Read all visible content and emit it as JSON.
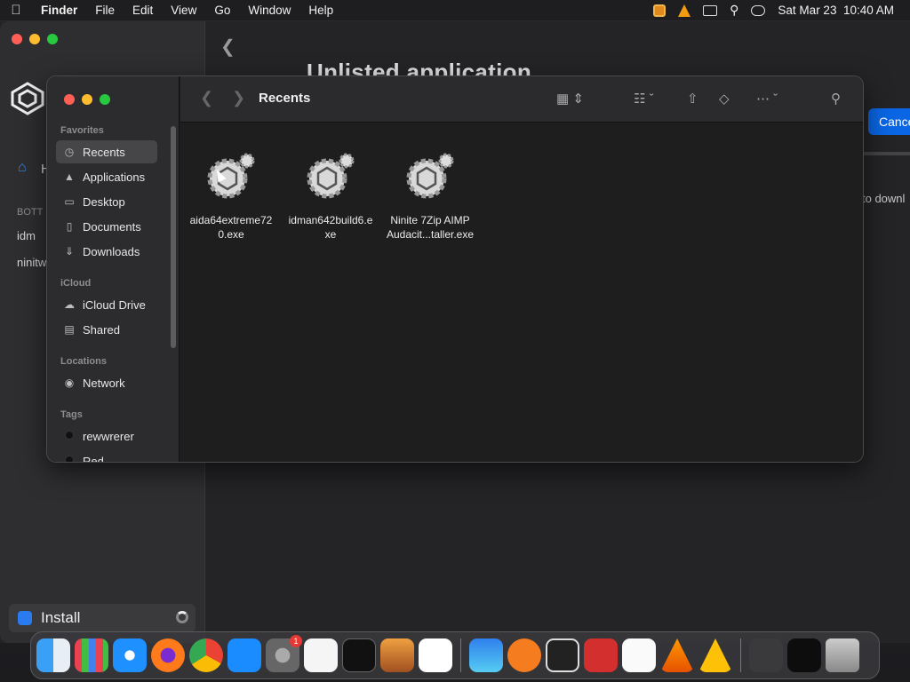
{
  "menubar": {
    "app_name": "Finder",
    "menus": [
      "File",
      "Edit",
      "View",
      "Go",
      "Window",
      "Help"
    ],
    "datetime": "Sat Mar 23  10:40 AM"
  },
  "background_window": {
    "title": "Unlisted application",
    "cancel_label": "Cance",
    "download_text": "to downl",
    "sidebar_home_label": "H",
    "sidebar_section": "BOTT",
    "sidebar_items": [
      "idm",
      "ninitw"
    ],
    "install_label": "Install"
  },
  "finder": {
    "title": "Recents",
    "sidebar": {
      "favorites_header": "Favorites",
      "favorites": [
        {
          "label": "Recents",
          "icon": "clock-icon"
        },
        {
          "label": "Applications",
          "icon": "applications-icon"
        },
        {
          "label": "Desktop",
          "icon": "desktop-icon"
        },
        {
          "label": "Documents",
          "icon": "document-icon"
        },
        {
          "label": "Downloads",
          "icon": "download-icon"
        }
      ],
      "icloud_header": "iCloud",
      "icloud": [
        {
          "label": "iCloud Drive",
          "icon": "cloud-icon"
        },
        {
          "label": "Shared",
          "icon": "shared-folder-icon"
        }
      ],
      "locations_header": "Locations",
      "locations": [
        {
          "label": "Network",
          "icon": "globe-icon"
        }
      ],
      "tags_header": "Tags",
      "tags": [
        {
          "label": "rewwrerer",
          "color": "#111111"
        },
        {
          "label": "Red",
          "color": "#111111"
        }
      ]
    },
    "files": [
      {
        "line1": "aida64extreme72",
        "line2": "0.exe"
      },
      {
        "line1": "idman642build6.e",
        "line2": "xe"
      },
      {
        "line1": "Ninite 7Zip AIMP",
        "line2": "Audacit...taller.exe"
      }
    ]
  },
  "dock": {
    "apps": [
      "finder-icon",
      "launchpad-icon",
      "safari-icon",
      "firefox-icon",
      "chrome-icon",
      "app-store-icon",
      "system-settings-icon",
      "textedit-icon",
      "terminal-icon",
      "garageband-icon",
      "vscode-icon",
      "cloud-app-icon",
      "screen-recorder-icon",
      "installer-app-icon",
      "photo-booth-icon",
      "calendar-icon",
      "vlc-icon",
      "aip-icon",
      "screenshot-folder-icon",
      "desktop-folder-icon",
      "trash-icon"
    ],
    "system_settings_badge": "1"
  }
}
